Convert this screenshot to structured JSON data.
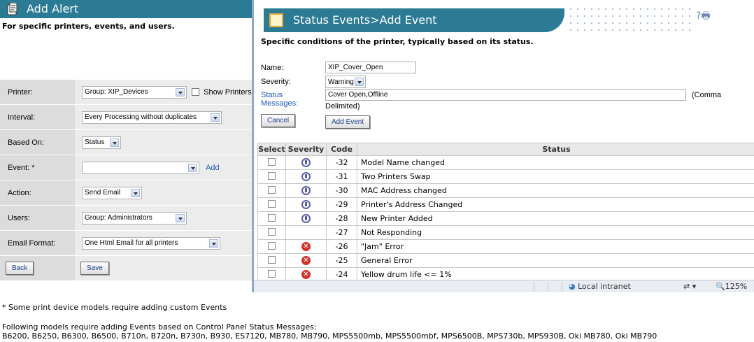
{
  "left_panel": {
    "title": "Add Alert",
    "subtitle": "For specific printers, events, and users.",
    "rows": [
      {
        "label": "Printer:",
        "value": "Group: XIP_Devices",
        "extra": "Show Printers"
      },
      {
        "label": "Interval:",
        "value": "Every Processing without duplicates"
      },
      {
        "label": "Based On:",
        "value": "Status"
      },
      {
        "label": "Event: *",
        "value": "",
        "extra": "Add"
      },
      {
        "label": "Action:",
        "value": "Send Email"
      },
      {
        "label": "Users:",
        "value": "Group: Administrators"
      },
      {
        "label": "Email Format:",
        "value": "One Html Email for all printers"
      }
    ],
    "back_label": "Back",
    "save_label": "Save"
  },
  "right_panel": {
    "title": "Status Events>Add Event",
    "subtitle": "Specific conditions of the printer, typically based on its status.",
    "name_label": "Name:",
    "name_value": "XIP_Cover_Open",
    "severity_label": "Severity:",
    "severity_value": "Warning",
    "status_label_1": "Status",
    "status_label_2": "Messages:",
    "status_value": "Cover Open,Offline",
    "comma_1": "(Comma",
    "comma_2": "Delimited)",
    "cancel_label": "Cancel",
    "add_event_label": "Add Event",
    "table_headers": [
      "Select",
      "Severity",
      "Code",
      "Status"
    ],
    "events": [
      {
        "severity": "info",
        "code": "-32",
        "status": "Model Name changed"
      },
      {
        "severity": "info",
        "code": "-31",
        "status": "Two Printers Swap"
      },
      {
        "severity": "info",
        "code": "-30",
        "status": "MAC Address changed"
      },
      {
        "severity": "info",
        "code": "-29",
        "status": "Printer's Address Changed"
      },
      {
        "severity": "info",
        "code": "-28",
        "status": "New Printer Added"
      },
      {
        "severity": "none",
        "code": "-27",
        "status": "Not Responding"
      },
      {
        "severity": "error",
        "code": "-26",
        "status": "\"Jam\" Error"
      },
      {
        "severity": "error",
        "code": "-25",
        "status": "General Error"
      },
      {
        "severity": "error",
        "code": "-24",
        "status": "Yellow drum life <= 1%"
      }
    ],
    "statusbar": {
      "zone": "Local intranet",
      "zoom": "125%"
    }
  },
  "notes": {
    "note1": "* Some print device models require adding custom Events",
    "note2": "Following models require adding Events based on Control Panel Status Messages:",
    "note3": "B6200, B6250, B6300, B6500, B710n, B720n, B730n, B930, ES7120, MB780, MB790, MPS5500mb, MPS5500mbf, MPS6500B, MPS730b, MPS930B, Oki MB780, Oki MB790"
  },
  "colors": {
    "title_bar": "#2b7b95",
    "error": "#d3332b",
    "info": "#5a5fa8"
  }
}
